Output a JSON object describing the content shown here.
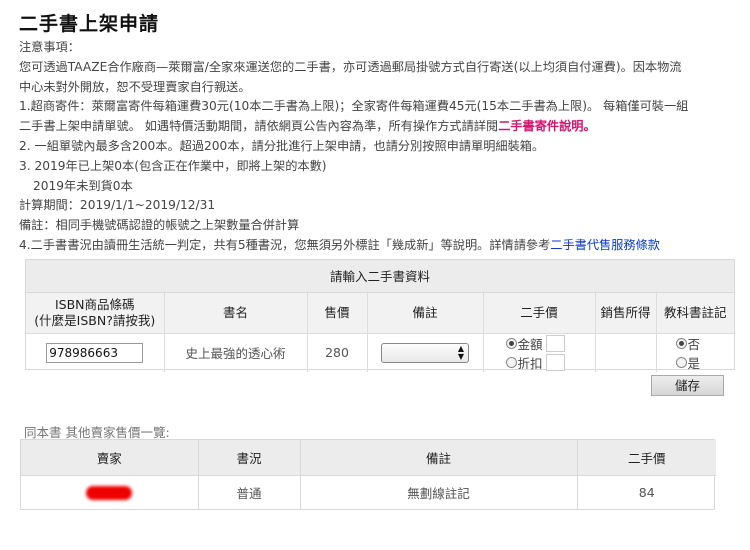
{
  "page_title": "二手書上架申請",
  "notice": {
    "heading": "注意事項：",
    "p1_line1": "您可透過TAAZE合作廠商—萊爾富/全家來運送您的二手書，亦可透過郵局掛號方式自行寄送(以上均須自付運費)。因本物流",
    "p1_line2": "中心未對外開放，恕不受理賣家自行親送。",
    "p2_line1": "1.超商寄件：萊爾富寄件每箱運費30元(10本二手書為上限)；全家寄件每箱運費45元(15本二手書為上限)。 每箱僅可裝一組",
    "p2_line2_text": "二手書上架申請單號。 如遇特價活動期間，請依網頁公告內容為準，所有操作方式請詳閱",
    "p2_link": "二手書寄件說明。",
    "p3": "2. 一組單號內最多含200本。超過200本，請分批進行上架申請，也請分別按照申請單明細裝箱。",
    "p4": "3. 2019年已上架0本(包含正在作業中，即將上架的本數)",
    "p5": "2019年未到貨0本",
    "p6": "計算期間：2019/1/1~2019/12/31",
    "p7": "備註：相同手機號碼認證的帳號之上架數量合併計算",
    "p8_text": "4.二手書書況由讀冊生活統一判定，共有5種書況，您無須另外標註「幾成新」等說明。詳情請參考",
    "p8_link": "二手書代售服務條款"
  },
  "form": {
    "heading": "請輸入二手書資料",
    "col_isbn_line1": "ISBN商品條碼",
    "col_isbn_line2": "(什麼是ISBN?請按我)",
    "col_title": "書名",
    "col_price": "售價",
    "col_note": "備註",
    "col_used_price": "二手價",
    "col_income": "銷售所得",
    "col_textbook": "教科書註記",
    "row": {
      "isbn_value": "978986663",
      "title": "史上最強的透心術",
      "price": "280",
      "used_price_option_amount": "金額",
      "used_price_option_discount": "折扣",
      "textbook_no": "否",
      "textbook_yes": "是"
    },
    "save_label": "儲存"
  },
  "others": {
    "heading": "同本書 其他賣家售價一覽:",
    "col_seller": "賣家",
    "col_condition": "書況",
    "col_note": "備註",
    "col_used_price": "二手價",
    "rows": [
      {
        "condition": "普通",
        "note": "無劃線註記",
        "used_price": "84"
      }
    ]
  },
  "colors": {
    "link_pink": "#d4146e",
    "link_blue": "#0b39c8",
    "redaction": "#ee0000"
  }
}
